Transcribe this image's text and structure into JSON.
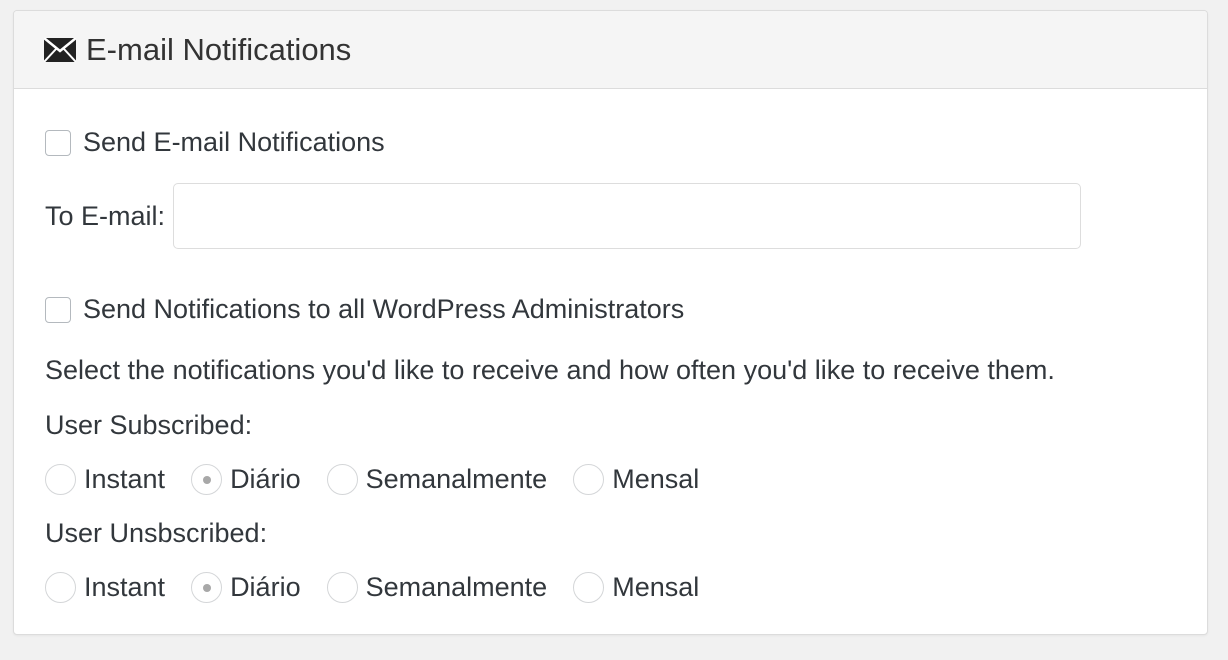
{
  "panel": {
    "title": "E-mail Notifications",
    "icon": "envelope-icon"
  },
  "send_email": {
    "label": "Send E-mail Notifications",
    "checked": false
  },
  "to_email": {
    "label": "To E-mail:",
    "value": ""
  },
  "send_admins": {
    "label": "Send Notifications to all WordPress Administrators",
    "checked": false
  },
  "description": "Select the notifications you'd like to receive and how often you'd like to receive them.",
  "user_subscribed": {
    "label": "User Subscribed:",
    "options": [
      "Instant",
      "Diário",
      "Semanalmente",
      "Mensal"
    ],
    "selected": "Diário"
  },
  "user_unsubscribed": {
    "label": "User Unsbscribed:",
    "options": [
      "Instant",
      "Diário",
      "Semanalmente",
      "Mensal"
    ],
    "selected": "Diário"
  }
}
